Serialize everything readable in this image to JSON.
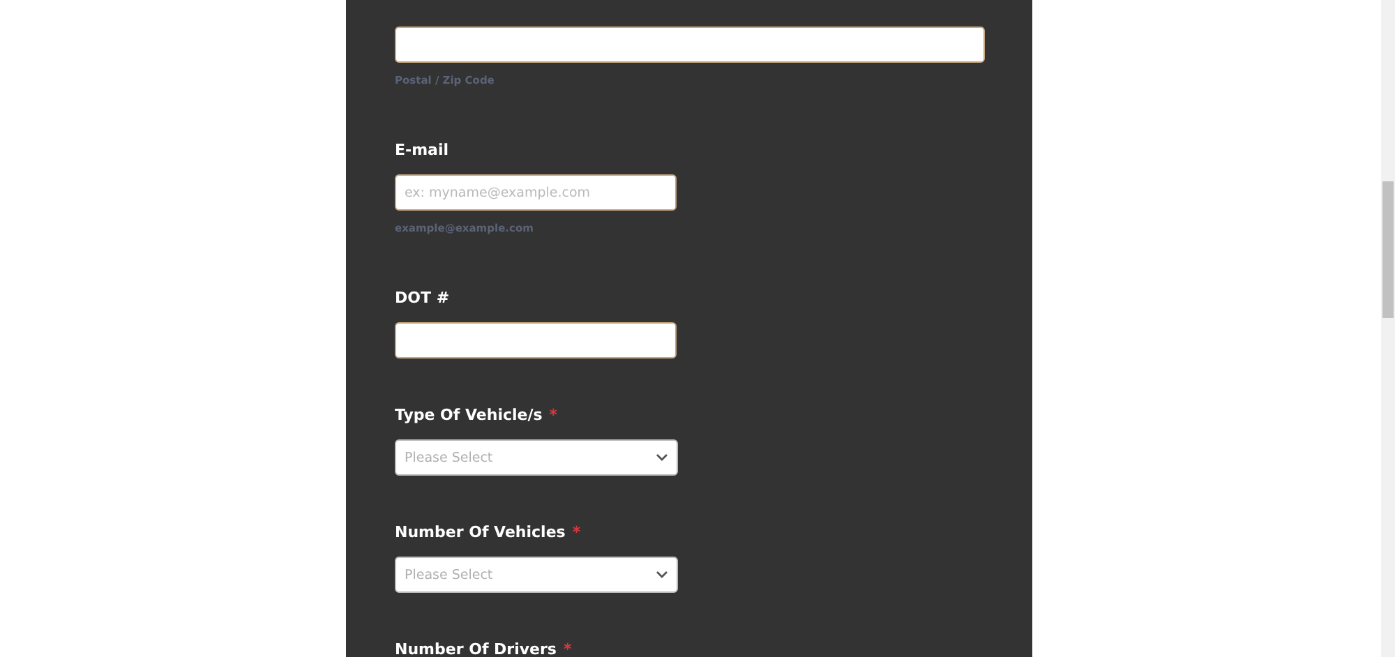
{
  "fields": [
    {
      "kind": "wide_text",
      "sublabel": "Postal / Zip Code"
    },
    {
      "kind": "text",
      "label": "E-mail",
      "placeholder": "ex: myname@example.com",
      "sublabel": "example@example.com"
    },
    {
      "kind": "text",
      "label": "DOT #"
    },
    {
      "kind": "select",
      "label": "Type Of Vehicle/s",
      "required_mark": "*",
      "placeholder": "Please Select"
    },
    {
      "kind": "select",
      "label": "Number Of Vehicles",
      "required_mark": "*",
      "placeholder": "Please Select"
    },
    {
      "kind": "none",
      "label": "Number Of Drivers",
      "required_mark": "*"
    }
  ]
}
